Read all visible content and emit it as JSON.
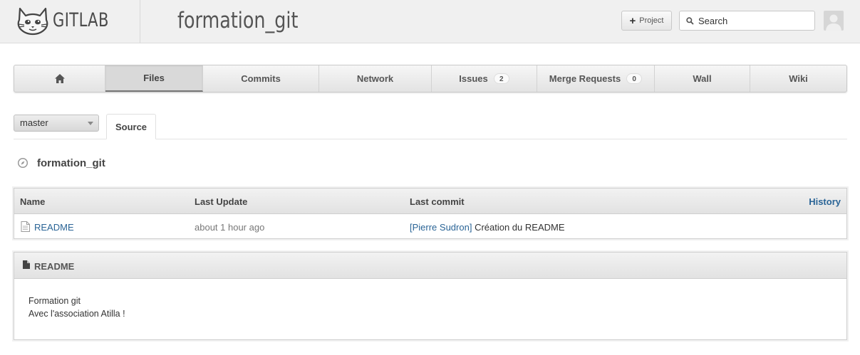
{
  "app": {
    "logo_text": "GITLAB",
    "project_title": "formation_git"
  },
  "header": {
    "new_project_label": "Project",
    "search": {
      "placeholder": "Search",
      "value": ""
    }
  },
  "mainnav": {
    "tabs": [
      {
        "label": "",
        "icon": "home-icon"
      },
      {
        "label": "Files",
        "active": true
      },
      {
        "label": "Commits"
      },
      {
        "label": "Network"
      },
      {
        "label": "Issues",
        "count": "2"
      },
      {
        "label": "Merge Requests",
        "count": "0"
      },
      {
        "label": "Wall"
      },
      {
        "label": "Wiki"
      }
    ]
  },
  "branch": {
    "selected": "master"
  },
  "subtabs": {
    "source": "Source"
  },
  "breadcrumb": {
    "project": "formation_git"
  },
  "tree": {
    "headers": {
      "name": "Name",
      "last_update": "Last Update",
      "last_commit": "Last commit",
      "history": "History"
    },
    "rows": [
      {
        "name": "README",
        "last_update": "about 1 hour ago",
        "author": "[Pierre Sudron]",
        "message": "Création du README"
      }
    ]
  },
  "readme": {
    "title": "README",
    "lines": [
      "Formation git",
      "Avec l'association Atilla !"
    ]
  },
  "colors": {
    "link": "#2a6496",
    "header_bg": "#f0f0f0",
    "active_tab": "#d9d9d9"
  }
}
